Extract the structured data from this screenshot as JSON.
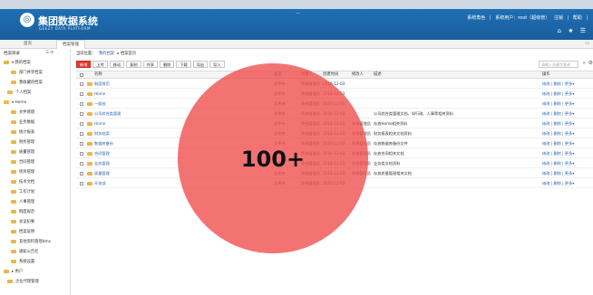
{
  "header": {
    "title": "集团数据系统",
    "subtitle": "GEEZY DATA PLATFORM",
    "user": [
      "系统角色",
      "|",
      "系统用户：root（超级管）",
      "注销",
      "|",
      "帮助",
      "|"
    ],
    "icons": [
      "home-icon",
      "star-icon",
      "gear-icon"
    ],
    "separator": "—"
  },
  "tabs": [
    {
      "label": "首页"
    },
    {
      "label": "档案管理"
    }
  ],
  "sidebar": {
    "head": "档案目录",
    "tools": "☰ ⟳",
    "items": [
      {
        "label": "▾ 我的档案",
        "indent": 0
      },
      {
        "label": "部门共享档案",
        "indent": 8
      },
      {
        "label": "我收藏的档案",
        "indent": 8
      },
      {
        "label": "个人档案",
        "indent": 4
      },
      {
        "label": "▾ Home",
        "indent": 0
      },
      {
        "label": "文件管理",
        "indent": 8
      },
      {
        "label": "业务数据",
        "indent": 8
      },
      {
        "label": "统计报表",
        "indent": 8
      },
      {
        "label": "财务管理",
        "indent": 8
      },
      {
        "label": "质量管理",
        "indent": 8
      },
      {
        "label": "合同管理",
        "indent": 8
      },
      {
        "label": "项目管理",
        "indent": 8
      },
      {
        "label": "技术文档",
        "indent": 8
      },
      {
        "label": "工作计划",
        "indent": 8
      },
      {
        "label": "人事管理",
        "indent": 8
      },
      {
        "label": "制度规范",
        "indent": 8
      },
      {
        "label": "会议纪要",
        "indent": 8
      },
      {
        "label": "档案说明",
        "indent": 8
      },
      {
        "label": "其他资料管理dms",
        "indent": 8
      },
      {
        "label": "通知公告栏",
        "indent": 8
      },
      {
        "label": "系统设置",
        "indent": 8
      },
      {
        "label": "▸ 用户",
        "indent": 0
      },
      {
        "label": "企业代理管理",
        "indent": 4
      }
    ]
  },
  "content": {
    "breadcrumb": [
      "当前位置：",
      "我的档案",
      "▸ 档案首页"
    ],
    "toolbar": [
      "新增",
      "上传",
      "移动",
      "复制",
      "共享",
      "删除",
      "下载",
      "导出",
      "导入"
    ],
    "search_placeholder": "请输入关键字查询",
    "columns": [
      "名称",
      "类型",
      "创建人",
      "创建时间",
      "修改人",
      "描述",
      "操作"
    ],
    "rows": [
      {
        "name": "制度规范",
        "type": "文件夹",
        "creator": "系统管理员",
        "time": "2016-12-03",
        "modifier": "",
        "desc": "",
        "ops": "修改 | 删除 | 更多▾"
      },
      {
        "name": "Home",
        "type": "文件夹",
        "creator": "系统管理员",
        "time": "2016-12-03",
        "modifier": "",
        "desc": "",
        "ops": "修改 | 删除 | 更多▾"
      },
      {
        "name": "一般档",
        "type": "文件夹",
        "creator": "系统管理员",
        "time": "2016-12-03",
        "modifier": "",
        "desc": "",
        "ops": "修改 | 删除 | 更多▾"
      },
      {
        "name": "公司综合类管理",
        "type": "文件夹",
        "creator": "系统管理员",
        "time": "2016-12-03",
        "modifier": "",
        "desc": "公司综合类管理文档，如行政、人事等相关资料",
        "ops": "修改 | 删除 | 更多▾"
      },
      {
        "name": "Home",
        "type": "文件夹",
        "creator": "系统管理员",
        "time": "2016-12-03",
        "modifier": "系统管理员",
        "desc": "存放Home相关资料",
        "ops": "修改 | 删除 | 更多▾"
      },
      {
        "name": "财务档案",
        "type": "文件夹",
        "creator": "系统管理员",
        "time": "2016-12-03",
        "modifier": "系统管理员",
        "desc": "财务报表相关文档资料",
        "ops": "修改 | 删除 | 更多▾"
      },
      {
        "name": "数据库备份",
        "type": "文件夹",
        "creator": "系统管理员",
        "time": "2016-12-03",
        "modifier": "系统管理员",
        "desc": "存放数据库备份文件",
        "ops": "修改 | 删除 | 更多▾"
      },
      {
        "name": "合同管理",
        "type": "文件夹",
        "creator": "系统管理员",
        "time": "2016-12-03",
        "modifier": "系统管理员",
        "desc": "存放合同相关文档",
        "ops": "修改 | 删除 | 更多▾"
      },
      {
        "name": "业务管理",
        "type": "文件夹",
        "creator": "系统管理员",
        "time": "2016-12-03",
        "modifier": "系统管理员",
        "desc": "业务类文档资料",
        "ops": "修改 | 删除 | 更多▾"
      },
      {
        "name": "质量管理",
        "type": "文件夹",
        "creator": "系统管理员",
        "time": "2016-12-03",
        "modifier": "系统管理员",
        "desc": "存放质量管理相关文档",
        "ops": "修改 | 删除 | 更多▾"
      },
      {
        "name": "开发部",
        "type": "文件夹",
        "creator": "系统管理员",
        "time": "2016-12-03",
        "modifier": "",
        "desc": "",
        "ops": "修改 | 删除 | 更多▾"
      }
    ]
  },
  "overlay": {
    "badge": "100+",
    "color": "#f05050"
  },
  "colors": {
    "header": "#1b64a6",
    "accent": "#e23b2e",
    "link": "#2a64b0",
    "folder": "#e8b74a"
  }
}
